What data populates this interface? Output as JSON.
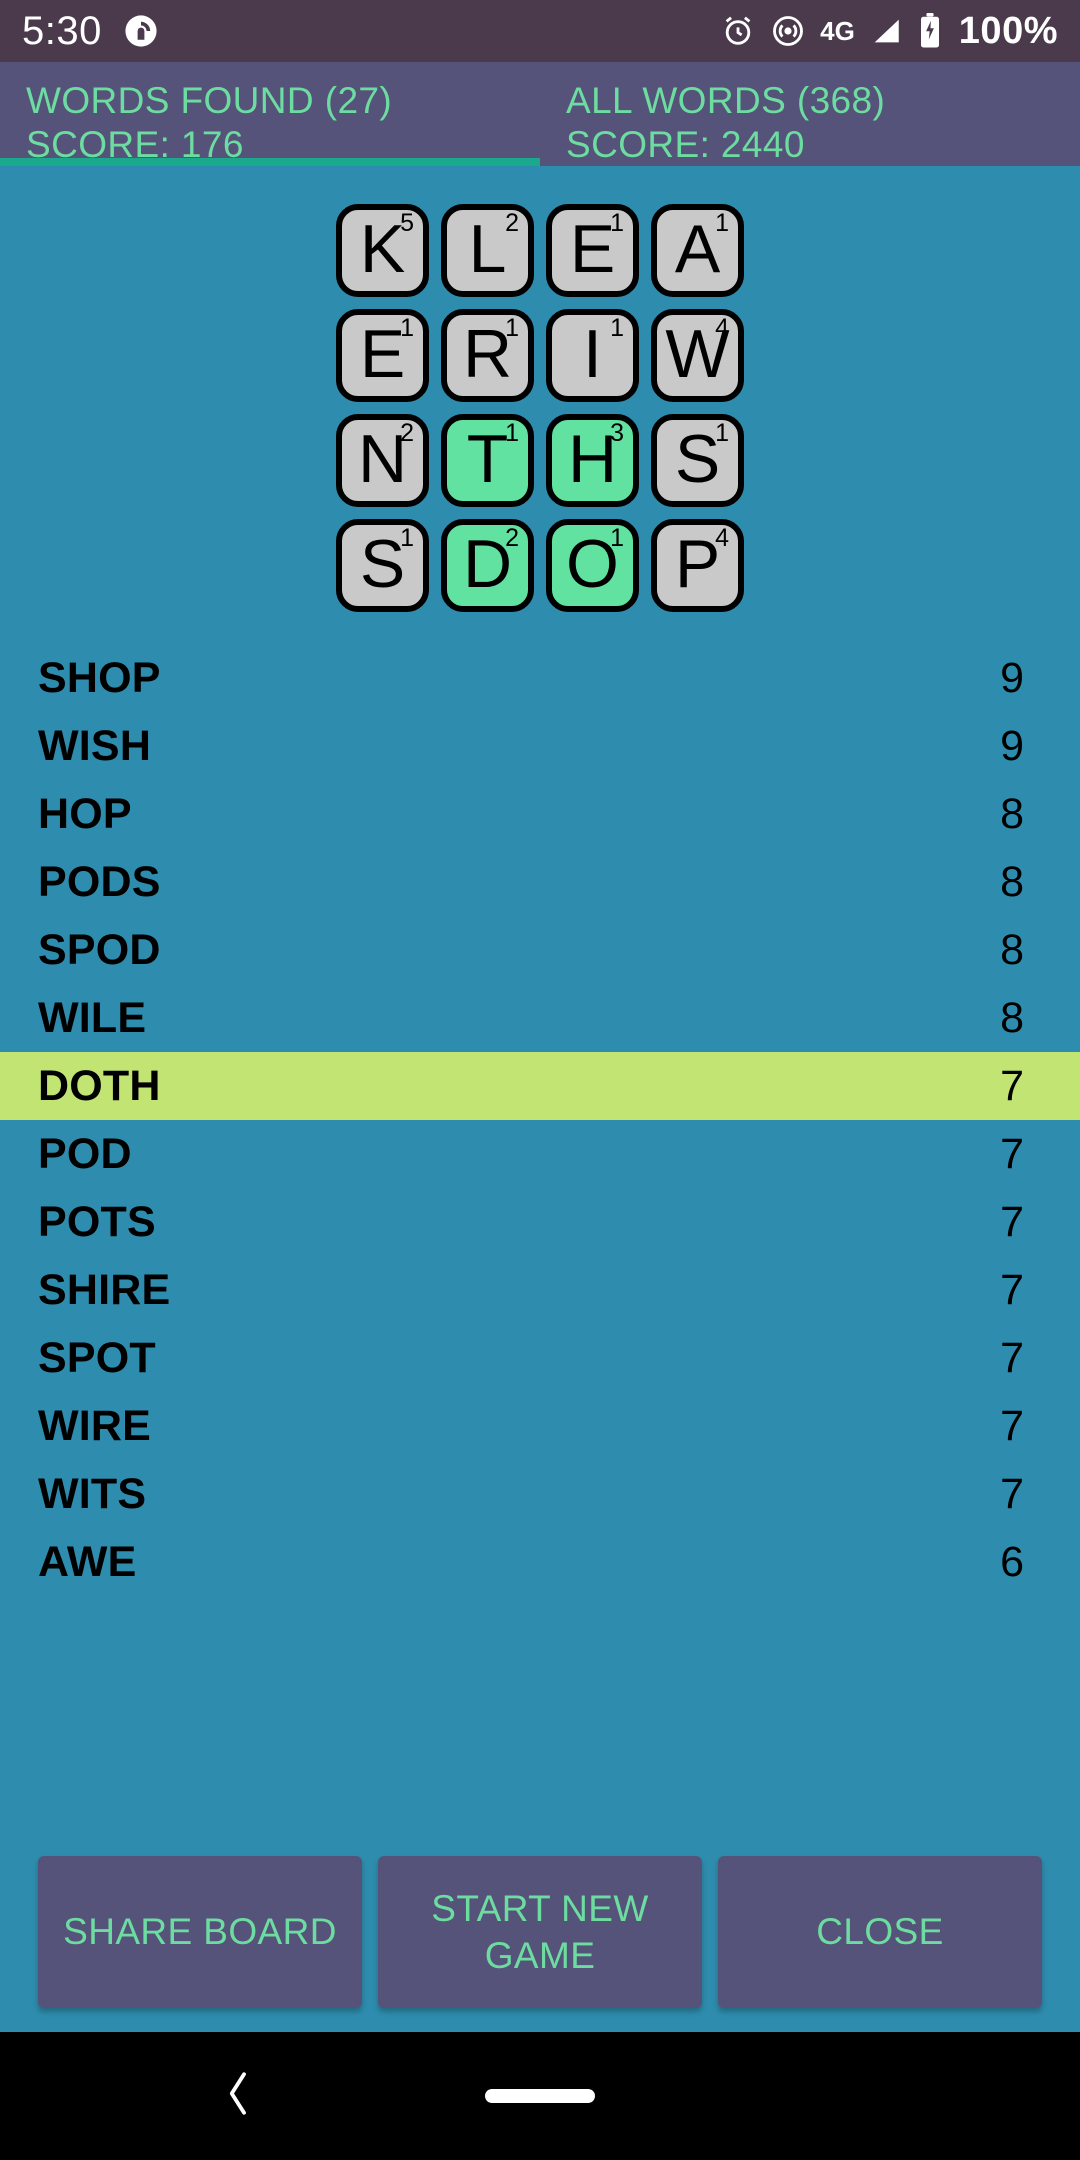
{
  "status_bar": {
    "time": "5:30",
    "app_icon": "pocketcasts-icon",
    "icons": [
      "alarm-icon",
      "cast-icon",
      "signal-icon",
      "battery-icon"
    ],
    "network": "4G",
    "battery_percent": "100%"
  },
  "tabs": [
    {
      "title": "WORDS FOUND (27)",
      "score": "SCORE: 176",
      "active": true
    },
    {
      "title": "ALL WORDS (368)",
      "score": "SCORE: 2440",
      "active": false
    }
  ],
  "colors": {
    "background": "#2e8dae",
    "header": "#56537a",
    "status_bar": "#4a3a4c",
    "accent_green": "#6ddca0",
    "tab_indicator": "#1aa98c",
    "tile": "#c9c9c9",
    "tile_selected": "#62e2a0",
    "row_highlight": "#c2e472",
    "button": "#56537a"
  },
  "board": {
    "rows": [
      [
        {
          "letter": "K",
          "value": "5",
          "selected": false
        },
        {
          "letter": "L",
          "value": "2",
          "selected": false
        },
        {
          "letter": "E",
          "value": "1",
          "selected": false
        },
        {
          "letter": "A",
          "value": "1",
          "selected": false
        }
      ],
      [
        {
          "letter": "E",
          "value": "1",
          "selected": false
        },
        {
          "letter": "R",
          "value": "1",
          "selected": false
        },
        {
          "letter": "I",
          "value": "1",
          "selected": false
        },
        {
          "letter": "W",
          "value": "4",
          "selected": false
        }
      ],
      [
        {
          "letter": "N",
          "value": "2",
          "selected": false
        },
        {
          "letter": "T",
          "value": "1",
          "selected": true
        },
        {
          "letter": "H",
          "value": "3",
          "selected": true
        },
        {
          "letter": "S",
          "value": "1",
          "selected": false
        }
      ],
      [
        {
          "letter": "S",
          "value": "1",
          "selected": false
        },
        {
          "letter": "D",
          "value": "2",
          "selected": true
        },
        {
          "letter": "O",
          "value": "1",
          "selected": true
        },
        {
          "letter": "P",
          "value": "4",
          "selected": false
        }
      ]
    ]
  },
  "word_list": [
    {
      "word": "SHOP",
      "score": "9",
      "highlighted": false
    },
    {
      "word": "WISH",
      "score": "9",
      "highlighted": false
    },
    {
      "word": "HOP",
      "score": "8",
      "highlighted": false
    },
    {
      "word": "PODS",
      "score": "8",
      "highlighted": false
    },
    {
      "word": "SPOD",
      "score": "8",
      "highlighted": false
    },
    {
      "word": "WILE",
      "score": "8",
      "highlighted": false
    },
    {
      "word": "DOTH",
      "score": "7",
      "highlighted": true
    },
    {
      "word": "POD",
      "score": "7",
      "highlighted": false
    },
    {
      "word": "POTS",
      "score": "7",
      "highlighted": false
    },
    {
      "word": "SHIRE",
      "score": "7",
      "highlighted": false
    },
    {
      "word": "SPOT",
      "score": "7",
      "highlighted": false
    },
    {
      "word": "WIRE",
      "score": "7",
      "highlighted": false
    },
    {
      "word": "WITS",
      "score": "7",
      "highlighted": false
    },
    {
      "word": "AWE",
      "score": "6",
      "highlighted": false
    }
  ],
  "buttons": [
    {
      "label": "SHARE BOARD",
      "name": "share-board-button"
    },
    {
      "label": "START NEW GAME",
      "name": "start-new-game-button"
    },
    {
      "label": "CLOSE",
      "name": "close-button"
    }
  ],
  "nav_bar": {
    "back_icon": "back-chevron-icon",
    "home_pill": "home-pill-icon"
  }
}
